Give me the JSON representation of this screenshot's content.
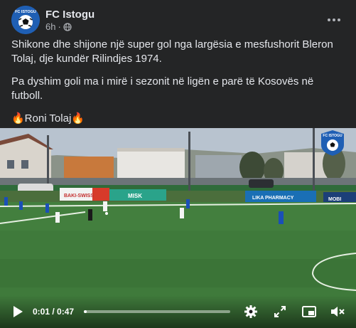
{
  "post": {
    "page_name": "FC Istogu",
    "time_ago": "6h",
    "avatar_text": "FC ISTOGU",
    "paragraphs": [
      "Shikone dhe shijone një super gol nga largësia e mesfushorit Bleron Tolaj, dje kundër Rilindjes 1974.",
      "Pa dyshim goli ma i mirë i sezonit në ligën e parë të Kosovës në futboll.",
      "🔥Roni Tolaj🔥"
    ]
  },
  "video": {
    "watermark_text": "FC ISTOGU",
    "boards": [
      "BAKI-SWISS",
      "MISK",
      "LIKA PHARMACY",
      "MOBI"
    ],
    "current_time": "0:01",
    "duration": "0:47",
    "progress": 0.02,
    "icons": [
      "play-icon",
      "settings-icon",
      "fullscreen-icon",
      "pip-icon",
      "volume-muted-icon"
    ]
  },
  "colors": {
    "card_bg": "#242526",
    "text_primary": "#e4e6eb",
    "text_secondary": "#b0b3b8",
    "club_blue": "#1f5fb4"
  }
}
